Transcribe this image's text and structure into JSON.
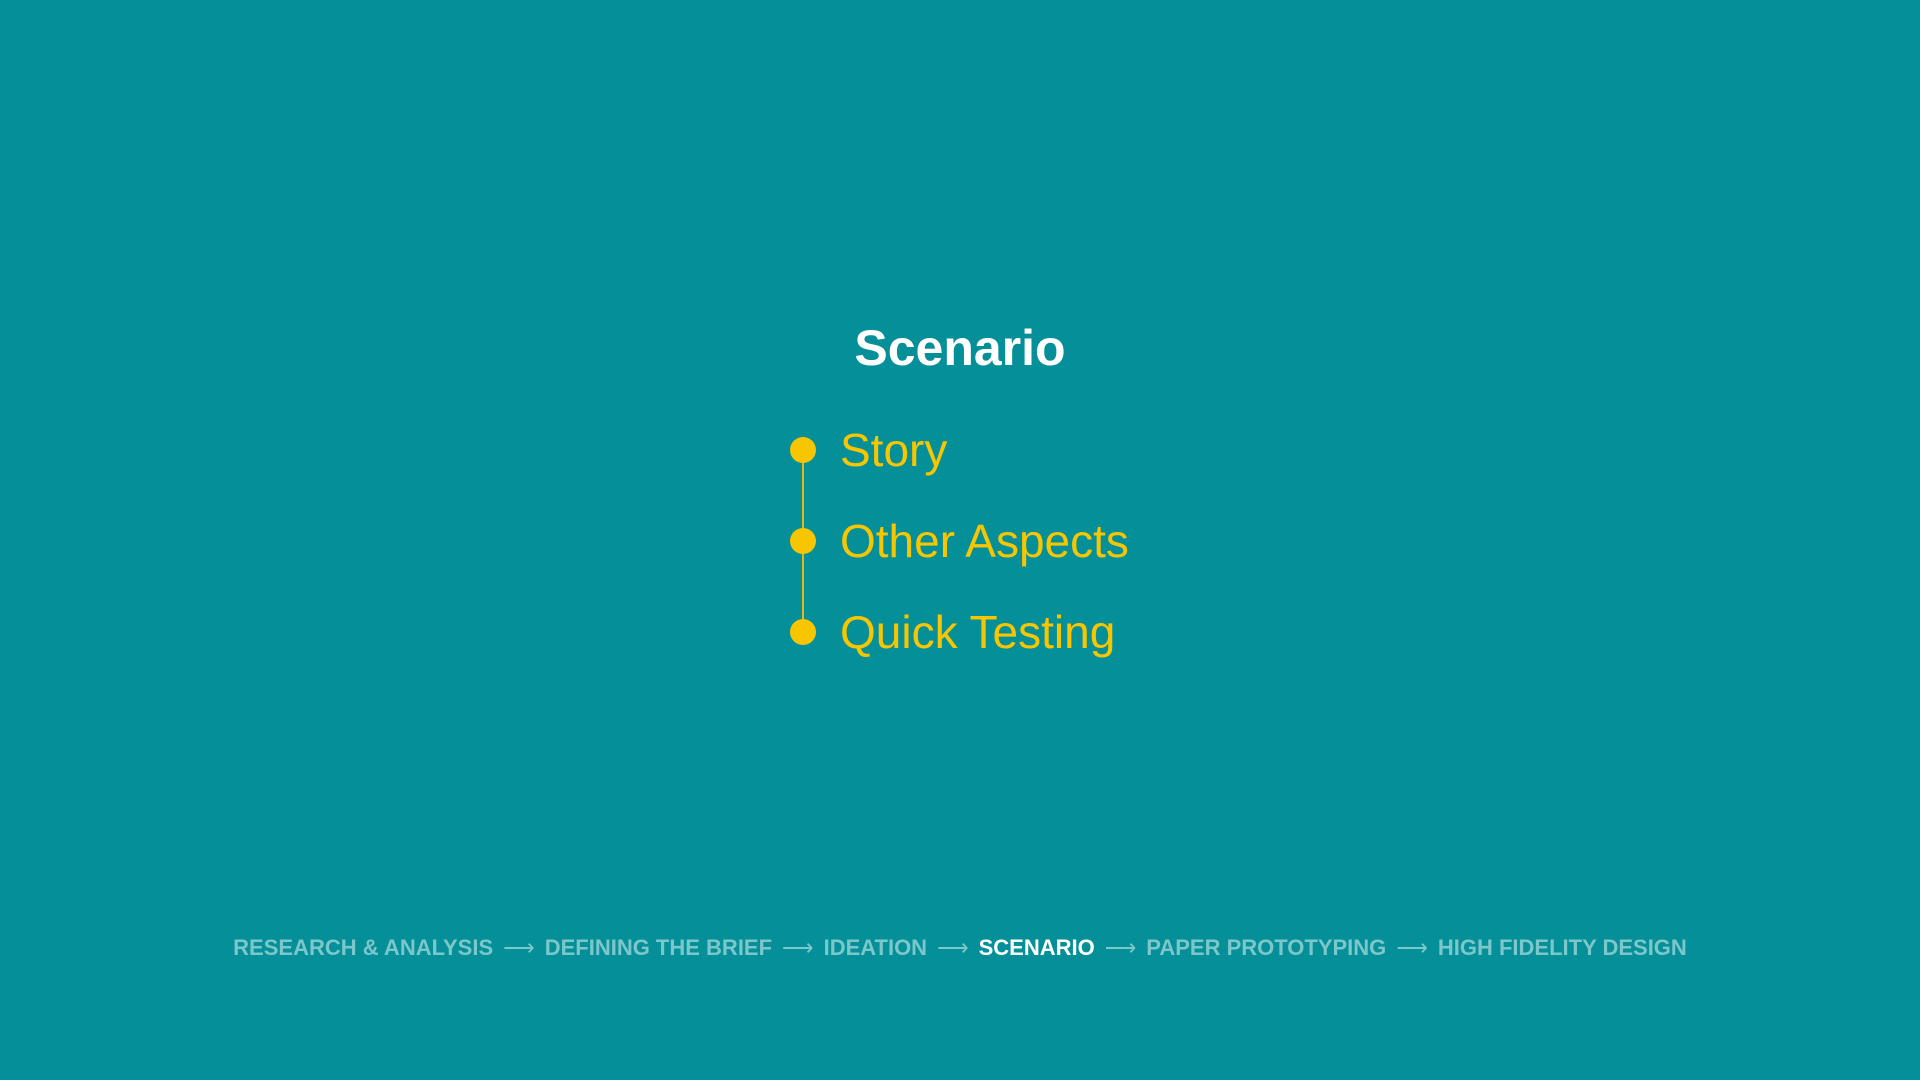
{
  "slide": {
    "title": "Scenario",
    "items": [
      {
        "label": "Story"
      },
      {
        "label": "Other Aspects"
      },
      {
        "label": "Quick Testing"
      }
    ]
  },
  "progress": {
    "steps": [
      {
        "label": "RESEARCH & ANALYSIS",
        "active": false
      },
      {
        "label": "DEFINING THE BRIEF",
        "active": false
      },
      {
        "label": "IDEATION",
        "active": false
      },
      {
        "label": "SCENARIO",
        "active": true
      },
      {
        "label": "PAPER PROTOTYPING",
        "active": false
      },
      {
        "label": "HIGH FIDELITY DESIGN",
        "active": false
      }
    ],
    "separator": "⟶"
  },
  "colors": {
    "background": "#058f99",
    "accent": "#f7c600",
    "title": "#ffffff",
    "step_inactive": "#7bc7c9",
    "step_active": "#ffffff"
  }
}
